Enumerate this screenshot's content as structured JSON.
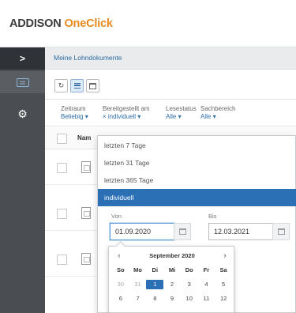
{
  "app": {
    "brand": "ADDISON",
    "product": "OneClick"
  },
  "nav": {
    "expand_glyph": ">",
    "breadcrumb": "Meine Lohndokumente"
  },
  "rail": {
    "icons": [
      "chevron-right-icon",
      "documents-icon",
      "gear-icon"
    ],
    "settings_glyph": "⚙"
  },
  "toolbar": {
    "refresh_glyph": "↻"
  },
  "filters": [
    {
      "label": "Zeitraum",
      "value": "Beliebig ▾"
    },
    {
      "label": "Bereitgestellt am",
      "value": "× individuell ▾"
    },
    {
      "label": "Lesestatus",
      "value": "Alle ▾"
    },
    {
      "label": "Sachbereich",
      "value": "Alle ▾"
    }
  ],
  "table": {
    "column_name": "Nam"
  },
  "dropdown": {
    "options": [
      "letzten 7 Tage",
      "letzten 31 Tage",
      "letzten 365 Tage",
      "individuell"
    ],
    "selected": "individuell",
    "from_label": "Von",
    "to_label": "Bis",
    "from_value": "01.09.2020",
    "to_value": "12.03.2021"
  },
  "datepicker": {
    "prev": "‹",
    "next": "›",
    "title": "September 2020",
    "weekdays": [
      "So",
      "Mo",
      "Di",
      "Mi",
      "Do",
      "Fr",
      "Sa"
    ],
    "days": [
      "30",
      "31",
      "1",
      "2",
      "3",
      "4",
      "5",
      "6",
      "7",
      "8",
      "9",
      "10",
      "11",
      "12"
    ],
    "selected_day": "1"
  },
  "colors": {
    "accent": "#2b6fb5",
    "brand_orange": "#e8891d",
    "rail": "#4a4d52",
    "link": "#2e6da4"
  }
}
